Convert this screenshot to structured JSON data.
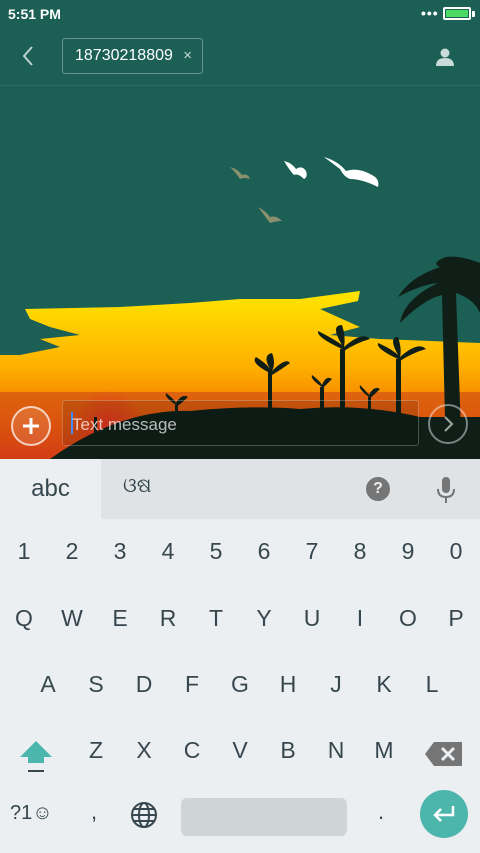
{
  "status_bar": {
    "time": "5:51 PM",
    "signal_dots": "•••",
    "battery_level": 1.0
  },
  "header": {
    "recipient": "18730218809",
    "chip_close": "×"
  },
  "compose": {
    "placeholder": "Text message"
  },
  "keyboard": {
    "mode_label": "abc",
    "alt_mode_label": "ଓଷ",
    "help_label": "?",
    "number_row": [
      "1",
      "2",
      "3",
      "4",
      "5",
      "6",
      "7",
      "8",
      "9",
      "0"
    ],
    "row1": [
      "Q",
      "W",
      "E",
      "R",
      "T",
      "Y",
      "U",
      "I",
      "O",
      "P"
    ],
    "row2": [
      "A",
      "S",
      "D",
      "F",
      "G",
      "H",
      "J",
      "K",
      "L"
    ],
    "row3": [
      "Z",
      "X",
      "C",
      "V",
      "B",
      "N",
      "M"
    ],
    "symbols_label": "?1☺",
    "comma": ",",
    "period": "."
  },
  "icons": {
    "back": "chevron-left-icon",
    "contact": "person-icon",
    "add": "plus-icon",
    "send": "chevron-right-icon",
    "help": "question-icon",
    "mic": "microphone-icon",
    "shift": "shift-arrow-icon",
    "backspace": "backspace-icon",
    "globe": "globe-icon",
    "enter": "enter-icon"
  },
  "colors": {
    "header_bg": "#1b5f55",
    "keyboard_bg": "#eceff1",
    "accent_teal": "#4db6ac",
    "battery_green": "#4cd964"
  }
}
